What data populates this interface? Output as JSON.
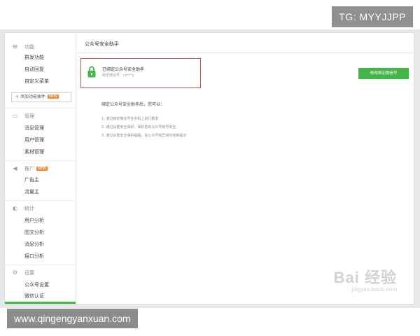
{
  "overlay": {
    "tg_tag": "TG: MYYJJPP",
    "url_tag": "www.qingengyanxuan.com"
  },
  "sidebar": {
    "sections": {
      "function": {
        "label": "功能",
        "icon": "grid-icon"
      },
      "manage": {
        "label": "管理",
        "icon": "chat-icon"
      },
      "promote": {
        "label": "推广",
        "icon": "megaphone-icon",
        "badge": "NEW"
      },
      "stats": {
        "label": "统计",
        "icon": "chart-icon"
      },
      "settings": {
        "label": "设置",
        "icon": "gear-icon"
      }
    },
    "items": {
      "mass_send": "群发功能",
      "auto_reply": "自动回复",
      "custom_menu": "自定义菜单",
      "add_plugin": "+ 添加功能插件",
      "add_plugin_badge": "NEW",
      "msg_manage": "消息管理",
      "user_manage": "用户管理",
      "material_manage": "素材管理",
      "advertiser": "广告主",
      "traffic_host": "流量主",
      "user_analysis": "用户分析",
      "article_analysis": "图文分析",
      "msg_analysis": "消息分析",
      "api_analysis": "接口分析",
      "account_settings": "公众号设置",
      "wechat_verify": "微信认证"
    }
  },
  "main": {
    "page_title": "公众号安全助手",
    "status": {
      "title": "已绑定公众号安全助手",
      "bound_account": "绑定微信号：cz***y"
    },
    "action_button": "修改绑定微信号",
    "intro": "绑定公众号安全助手后，您可以：",
    "tips": [
      "1. 通过绑定微信号在手机上进行群发",
      "2. 通过设置安全保护，保护您的公众号帐号安全",
      "3. 通过设置安全保护提醒，在公众号有异常时收到提示"
    ]
  },
  "watermark": {
    "logo": "Bai 经验",
    "url": "jingyan.baidu.com"
  },
  "colors": {
    "accent_green": "#44b549",
    "highlight_red": "#b55050",
    "new_badge": "#f08a3c"
  }
}
